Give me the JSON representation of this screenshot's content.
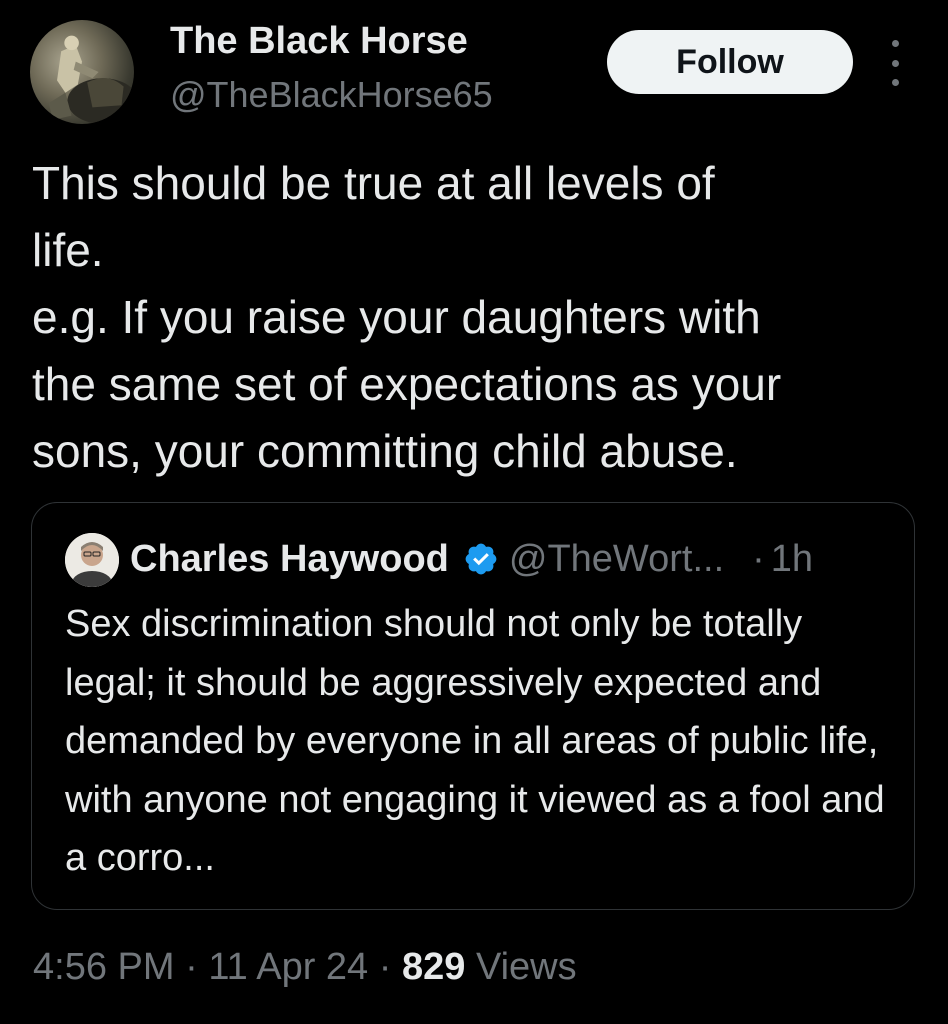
{
  "author": {
    "name": "The Black Horse",
    "handle": "@TheBlackHorse65",
    "avatar_icon": "avatar-rider-painting"
  },
  "follow_button": {
    "label": "Follow",
    "background": "#eff3f4",
    "text_color": "#0f1419"
  },
  "more_options_icon": "vertical-ellipsis-icon",
  "tweet": {
    "text": "This should be true at all levels of\nlife.\ne.g. If you raise your daughters with\nthe same set of expectations as your\nsons, your committing child abuse."
  },
  "quoted_tweet": {
    "author_name": "Charles Haywood",
    "verified": true,
    "verified_color": "#1d9bf0",
    "handle": "@TheWort...",
    "separator": "·",
    "time": "1h",
    "text": "Sex discrimination should not only be totally legal; it should be aggressively expected and demanded by everyone in all areas of public life, with anyone not engaging it viewed as a fool and a corro..."
  },
  "meta": {
    "time": "4:56 PM",
    "separator": "·",
    "date": "11 Apr 24",
    "views_count": "829",
    "views_label": "Views"
  },
  "colors": {
    "background": "#000000",
    "primary_text": "#e7e9ea",
    "secondary_text": "#71767b",
    "border": "#2f3336"
  }
}
